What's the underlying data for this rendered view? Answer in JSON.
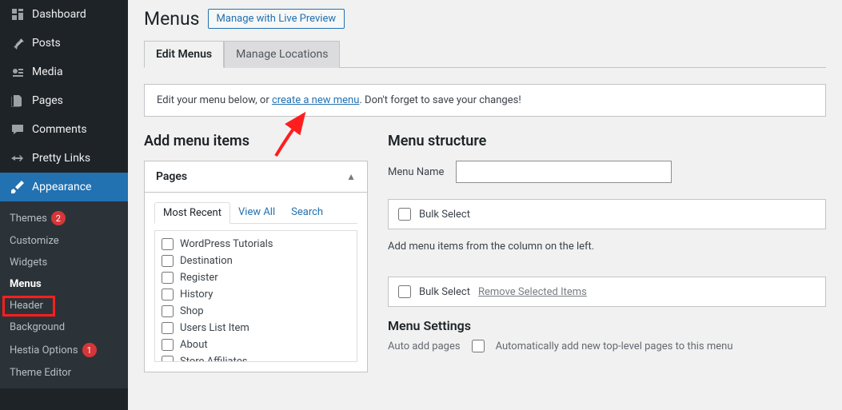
{
  "sidebar": {
    "main": [
      {
        "label": "Dashboard",
        "icon": "dashboard"
      },
      {
        "label": "Posts",
        "icon": "pin"
      },
      {
        "label": "Media",
        "icon": "media"
      },
      {
        "label": "Pages",
        "icon": "pages"
      },
      {
        "label": "Comments",
        "icon": "comments"
      },
      {
        "label": "Pretty Links",
        "icon": "prettylinks"
      },
      {
        "label": "Appearance",
        "icon": "brush",
        "active": true
      }
    ],
    "sub": [
      {
        "label": "Themes",
        "badge": "2"
      },
      {
        "label": "Customize"
      },
      {
        "label": "Widgets"
      },
      {
        "label": "Menus",
        "current": true
      },
      {
        "label": "Header"
      },
      {
        "label": "Background"
      },
      {
        "label": "Hestia Options",
        "badge": "1"
      },
      {
        "label": "Theme Editor"
      }
    ]
  },
  "page": {
    "title": "Menus",
    "live_preview": "Manage with Live Preview",
    "tabs": [
      {
        "label": "Edit Menus",
        "active": true
      },
      {
        "label": "Manage Locations"
      }
    ],
    "notice_pre": "Edit your menu below, or ",
    "notice_link": "create a new menu",
    "notice_post": ". Don't forget to save your changes!"
  },
  "left": {
    "heading": "Add menu items",
    "accordion_title": "Pages",
    "inner_tabs": [
      {
        "label": "Most Recent",
        "active": true
      },
      {
        "label": "View All"
      },
      {
        "label": "Search"
      }
    ],
    "pages": [
      "WordPress Tutorials",
      "Destination",
      "Register",
      "History",
      "Shop",
      "Users List Item",
      "About",
      "Store Affiliates"
    ]
  },
  "right": {
    "heading": "Menu structure",
    "menu_name_label": "Menu Name",
    "menu_name_value": "",
    "bulk_select": "Bulk Select",
    "info": "Add menu items from the column on the left.",
    "remove_selected": "Remove Selected Items",
    "menu_settings_h": "Menu Settings",
    "auto_add_label": "Auto add pages",
    "auto_add_opt": "Automatically add new top-level pages to this menu"
  }
}
